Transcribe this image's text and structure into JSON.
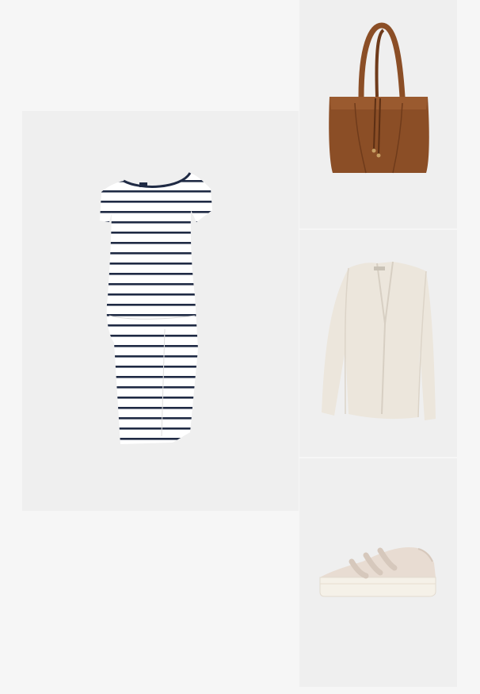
{
  "outfit": {
    "items": [
      {
        "id": "dress",
        "image_icon": "striped-jersey-dress-image",
        "colors": {
          "base": "#ffffff",
          "stripe": "#1f2a44"
        }
      },
      {
        "id": "bag",
        "image_icon": "suede-tote-bag-image",
        "colors": {
          "body": "#8b4e26",
          "shade": "#6f3b1b"
        }
      },
      {
        "id": "cardigan",
        "image_icon": "knit-cardigan-image",
        "colors": {
          "body": "#ece6dc",
          "shade": "#d7cfc3"
        }
      },
      {
        "id": "sneaker",
        "image_icon": "velcro-sneaker-image",
        "colors": {
          "upper": "#e8dcd2",
          "sole": "#f5f1e8"
        }
      }
    ]
  }
}
